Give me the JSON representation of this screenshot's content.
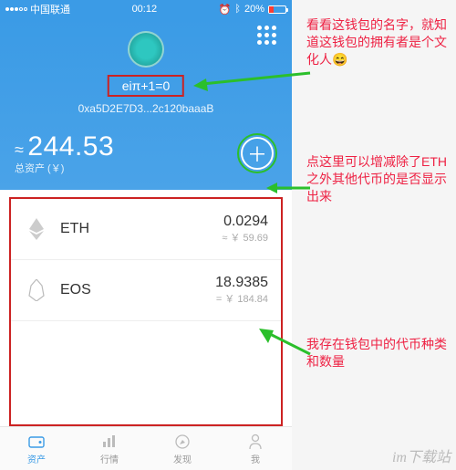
{
  "status": {
    "carrier": "中国联通",
    "time": "00:12",
    "bluetooth": "20%"
  },
  "wallet": {
    "name": "eiπ+1=0",
    "address": "0xa5D2E7D3...2c120baaaB",
    "balance": "244.53",
    "balance_label": "总资产 (￥)"
  },
  "tokens": [
    {
      "symbol": "ETH",
      "amount": "0.0294",
      "fiat": "≈ ￥ 59.69"
    },
    {
      "symbol": "EOS",
      "amount": "18.9385",
      "fiat": "= ￥ 184.84"
    }
  ],
  "nav": {
    "items": [
      "资产",
      "行情",
      "发现",
      "我"
    ]
  },
  "notes": {
    "n1": "看看这钱包的名字，就知道这钱包的拥有者是个文化人😄",
    "n2": "点这里可以增减除了ETH之外其他代币的是否显示出来",
    "n3": "我存在钱包中的代币种类和数量"
  },
  "watermark": "im下载站"
}
